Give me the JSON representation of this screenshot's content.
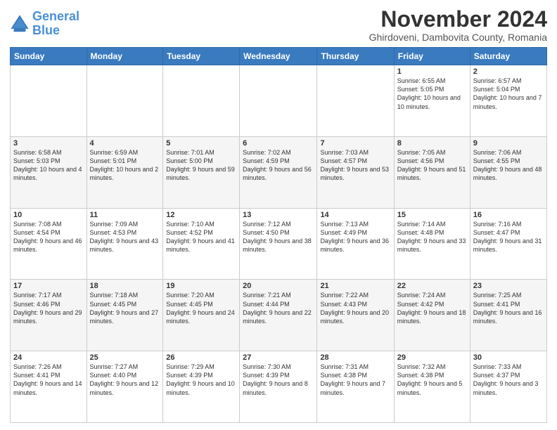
{
  "logo": {
    "line1": "General",
    "line2": "Blue"
  },
  "title": "November 2024",
  "subtitle": "Ghirdoveni, Dambovita County, Romania",
  "days_header": [
    "Sunday",
    "Monday",
    "Tuesday",
    "Wednesday",
    "Thursday",
    "Friday",
    "Saturday"
  ],
  "weeks": [
    [
      {
        "day": "",
        "info": ""
      },
      {
        "day": "",
        "info": ""
      },
      {
        "day": "",
        "info": ""
      },
      {
        "day": "",
        "info": ""
      },
      {
        "day": "",
        "info": ""
      },
      {
        "day": "1",
        "info": "Sunrise: 6:55 AM\nSunset: 5:05 PM\nDaylight: 10 hours\nand 10 minutes."
      },
      {
        "day": "2",
        "info": "Sunrise: 6:57 AM\nSunset: 5:04 PM\nDaylight: 10 hours\nand 7 minutes."
      }
    ],
    [
      {
        "day": "3",
        "info": "Sunrise: 6:58 AM\nSunset: 5:03 PM\nDaylight: 10 hours\nand 4 minutes."
      },
      {
        "day": "4",
        "info": "Sunrise: 6:59 AM\nSunset: 5:01 PM\nDaylight: 10 hours\nand 2 minutes."
      },
      {
        "day": "5",
        "info": "Sunrise: 7:01 AM\nSunset: 5:00 PM\nDaylight: 9 hours\nand 59 minutes."
      },
      {
        "day": "6",
        "info": "Sunrise: 7:02 AM\nSunset: 4:59 PM\nDaylight: 9 hours\nand 56 minutes."
      },
      {
        "day": "7",
        "info": "Sunrise: 7:03 AM\nSunset: 4:57 PM\nDaylight: 9 hours\nand 53 minutes."
      },
      {
        "day": "8",
        "info": "Sunrise: 7:05 AM\nSunset: 4:56 PM\nDaylight: 9 hours\nand 51 minutes."
      },
      {
        "day": "9",
        "info": "Sunrise: 7:06 AM\nSunset: 4:55 PM\nDaylight: 9 hours\nand 48 minutes."
      }
    ],
    [
      {
        "day": "10",
        "info": "Sunrise: 7:08 AM\nSunset: 4:54 PM\nDaylight: 9 hours\nand 46 minutes."
      },
      {
        "day": "11",
        "info": "Sunrise: 7:09 AM\nSunset: 4:53 PM\nDaylight: 9 hours\nand 43 minutes."
      },
      {
        "day": "12",
        "info": "Sunrise: 7:10 AM\nSunset: 4:52 PM\nDaylight: 9 hours\nand 41 minutes."
      },
      {
        "day": "13",
        "info": "Sunrise: 7:12 AM\nSunset: 4:50 PM\nDaylight: 9 hours\nand 38 minutes."
      },
      {
        "day": "14",
        "info": "Sunrise: 7:13 AM\nSunset: 4:49 PM\nDaylight: 9 hours\nand 36 minutes."
      },
      {
        "day": "15",
        "info": "Sunrise: 7:14 AM\nSunset: 4:48 PM\nDaylight: 9 hours\nand 33 minutes."
      },
      {
        "day": "16",
        "info": "Sunrise: 7:16 AM\nSunset: 4:47 PM\nDaylight: 9 hours\nand 31 minutes."
      }
    ],
    [
      {
        "day": "17",
        "info": "Sunrise: 7:17 AM\nSunset: 4:46 PM\nDaylight: 9 hours\nand 29 minutes."
      },
      {
        "day": "18",
        "info": "Sunrise: 7:18 AM\nSunset: 4:45 PM\nDaylight: 9 hours\nand 27 minutes."
      },
      {
        "day": "19",
        "info": "Sunrise: 7:20 AM\nSunset: 4:45 PM\nDaylight: 9 hours\nand 24 minutes."
      },
      {
        "day": "20",
        "info": "Sunrise: 7:21 AM\nSunset: 4:44 PM\nDaylight: 9 hours\nand 22 minutes."
      },
      {
        "day": "21",
        "info": "Sunrise: 7:22 AM\nSunset: 4:43 PM\nDaylight: 9 hours\nand 20 minutes."
      },
      {
        "day": "22",
        "info": "Sunrise: 7:24 AM\nSunset: 4:42 PM\nDaylight: 9 hours\nand 18 minutes."
      },
      {
        "day": "23",
        "info": "Sunrise: 7:25 AM\nSunset: 4:41 PM\nDaylight: 9 hours\nand 16 minutes."
      }
    ],
    [
      {
        "day": "24",
        "info": "Sunrise: 7:26 AM\nSunset: 4:41 PM\nDaylight: 9 hours\nand 14 minutes."
      },
      {
        "day": "25",
        "info": "Sunrise: 7:27 AM\nSunset: 4:40 PM\nDaylight: 9 hours\nand 12 minutes."
      },
      {
        "day": "26",
        "info": "Sunrise: 7:29 AM\nSunset: 4:39 PM\nDaylight: 9 hours\nand 10 minutes."
      },
      {
        "day": "27",
        "info": "Sunrise: 7:30 AM\nSunset: 4:39 PM\nDaylight: 9 hours\nand 8 minutes."
      },
      {
        "day": "28",
        "info": "Sunrise: 7:31 AM\nSunset: 4:38 PM\nDaylight: 9 hours\nand 7 minutes."
      },
      {
        "day": "29",
        "info": "Sunrise: 7:32 AM\nSunset: 4:38 PM\nDaylight: 9 hours\nand 5 minutes."
      },
      {
        "day": "30",
        "info": "Sunrise: 7:33 AM\nSunset: 4:37 PM\nDaylight: 9 hours\nand 3 minutes."
      }
    ]
  ]
}
